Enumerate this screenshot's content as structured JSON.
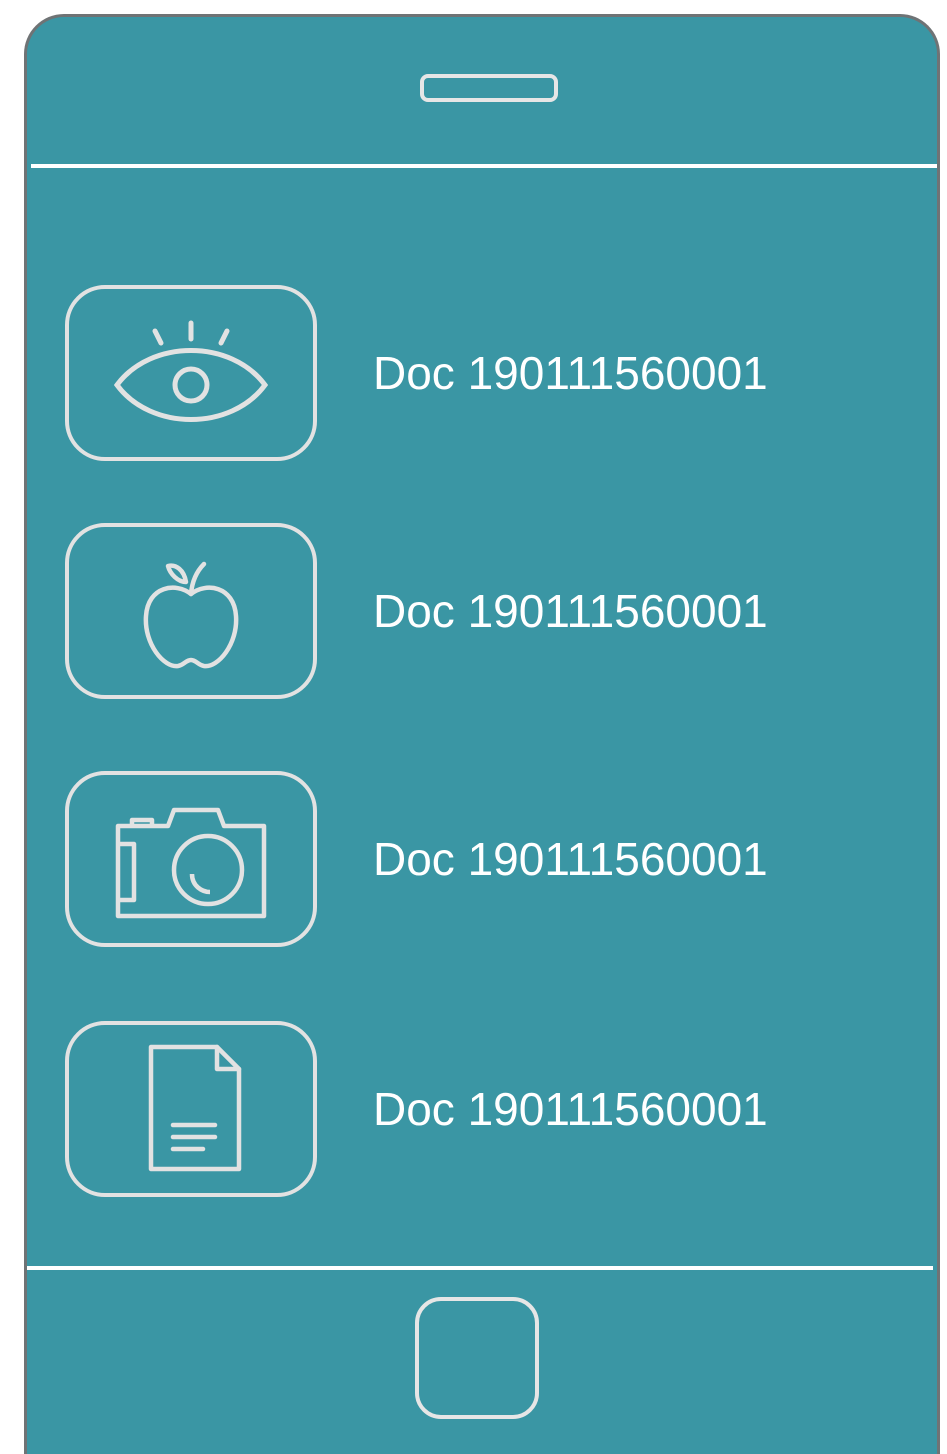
{
  "colors": {
    "device_background": "#3a96a4",
    "device_border": "#6f7375",
    "line": "#ffffff",
    "icon_stroke": "#e2e2e2",
    "text": "#ffffff"
  },
  "list": {
    "items": [
      {
        "icon": "eye-icon",
        "label": "Doc 190111560001"
      },
      {
        "icon": "apple-icon",
        "label": "Doc 190111560001"
      },
      {
        "icon": "camera-icon",
        "label": "Doc 190111560001"
      },
      {
        "icon": "document-icon",
        "label": "Doc 190111560001"
      }
    ]
  }
}
